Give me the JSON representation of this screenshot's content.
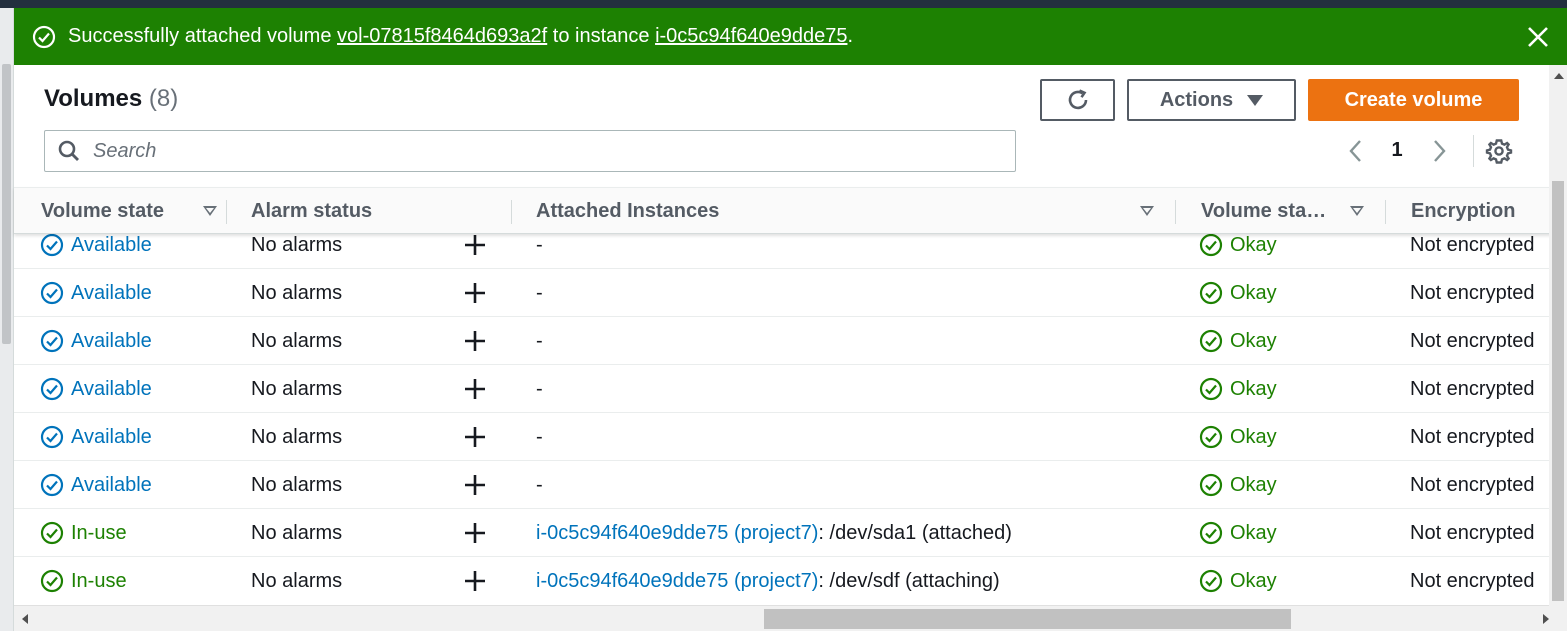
{
  "flash": {
    "prefix": "Successfully attached volume ",
    "volume_id": "vol-07815f8464d693a2f",
    "middle": " to instance ",
    "instance_id": "i-0c5c94f640e9dde75",
    "suffix": "."
  },
  "header": {
    "title": "Volumes",
    "count": "(8)",
    "actions_label": "Actions",
    "create_label": "Create volume"
  },
  "search": {
    "placeholder": "Search",
    "value": ""
  },
  "pagination": {
    "current_page": "1"
  },
  "columns": {
    "volume_state": "Volume state",
    "alarm_status": "Alarm status",
    "attached_instances": "Attached Instances",
    "volume_status": "Volume sta…",
    "encryption": "Encryption"
  },
  "rows": [
    {
      "state": "Available",
      "alarm": "No alarms",
      "instance_link": "",
      "instance_detail": "-",
      "status": "Okay",
      "encryption": "Not encrypted"
    },
    {
      "state": "Available",
      "alarm": "No alarms",
      "instance_link": "",
      "instance_detail": "-",
      "status": "Okay",
      "encryption": "Not encrypted"
    },
    {
      "state": "Available",
      "alarm": "No alarms",
      "instance_link": "",
      "instance_detail": "-",
      "status": "Okay",
      "encryption": "Not encrypted"
    },
    {
      "state": "Available",
      "alarm": "No alarms",
      "instance_link": "",
      "instance_detail": "-",
      "status": "Okay",
      "encryption": "Not encrypted"
    },
    {
      "state": "Available",
      "alarm": "No alarms",
      "instance_link": "",
      "instance_detail": "-",
      "status": "Okay",
      "encryption": "Not encrypted"
    },
    {
      "state": "Available",
      "alarm": "No alarms",
      "instance_link": "",
      "instance_detail": "-",
      "status": "Okay",
      "encryption": "Not encrypted"
    },
    {
      "state": "In-use",
      "alarm": "No alarms",
      "instance_link": "i-0c5c94f640e9dde75 (project7)",
      "instance_detail": ": /dev/sda1 (attached)",
      "status": "Okay",
      "encryption": "Not encrypted"
    },
    {
      "state": "In-use",
      "alarm": "No alarms",
      "instance_link": "i-0c5c94f640e9dde75 (project7)",
      "instance_detail": ": /dev/sdf (attaching)",
      "status": "Okay",
      "encryption": "Not encrypted"
    }
  ],
  "colors": {
    "success_bg": "#1d8102",
    "link_blue": "#0073bb",
    "primary_orange": "#ec7211",
    "status_green": "#1d8102"
  },
  "icons": {
    "flash": "success-check-icon",
    "close": "close-icon",
    "refresh": "refresh-icon",
    "actions": "caret-down-icon",
    "search": "search-icon",
    "prev": "chevron-left-icon",
    "next": "chevron-right-icon",
    "settings": "gear-icon",
    "available": "check-circle-blue-icon",
    "in_use": "check-circle-green-icon",
    "okay": "check-circle-green-icon",
    "add_alarm": "plus-icon"
  }
}
